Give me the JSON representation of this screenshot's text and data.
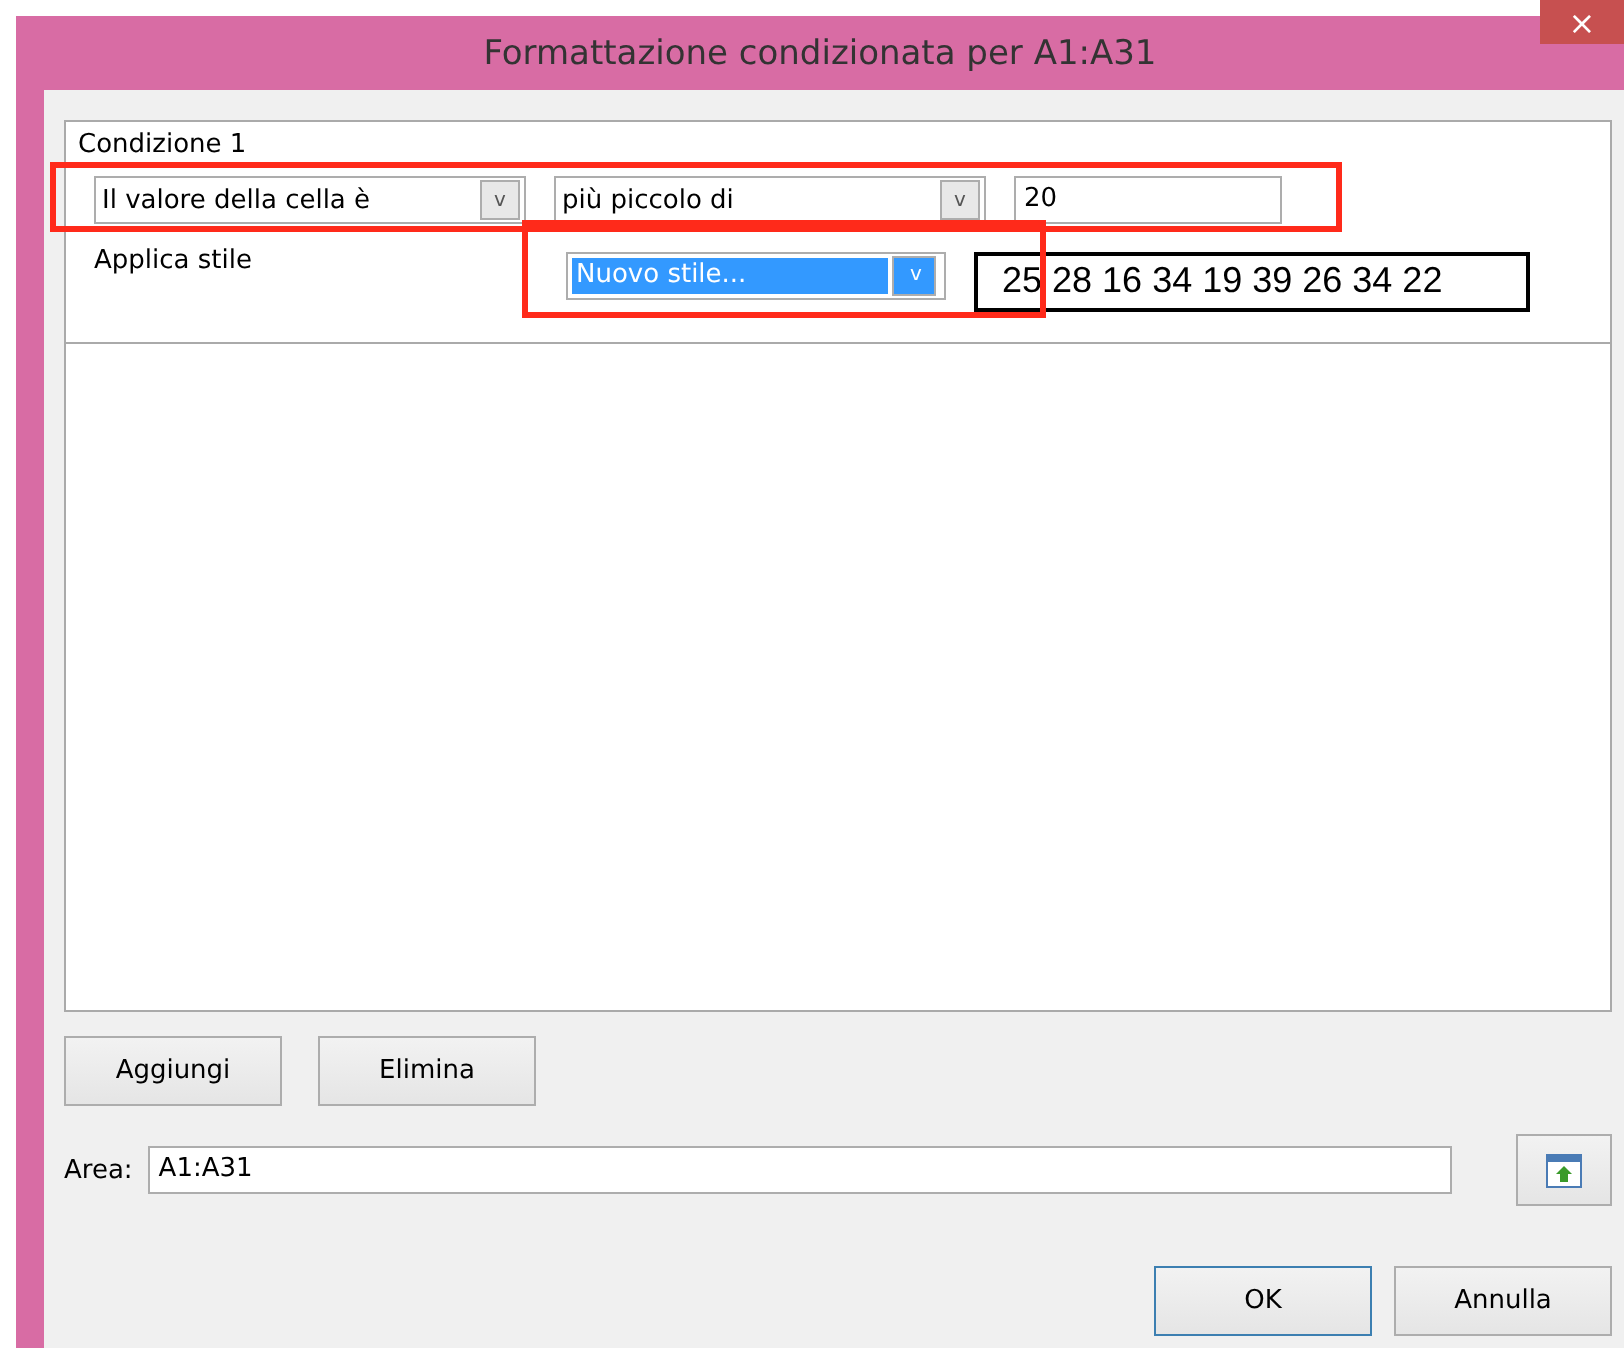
{
  "window": {
    "title": "Formattazione condizionata per A1:A31",
    "close": "×"
  },
  "conditions": [
    {
      "title": "Condizione 1",
      "highlighted": true,
      "type": {
        "value": "Il valore della cella è",
        "arrow": "v"
      },
      "operator": {
        "value": "più piccolo di",
        "arrow": "v"
      },
      "value": "20",
      "style_label": "Applica stile",
      "style": {
        "value": "Nuovo stile...",
        "arrow": "v",
        "selected": true,
        "highlighted": true
      },
      "preview": "25 28 16 34 19 39 26 34 22"
    }
  ],
  "buttons": [
    {
      "label": "Aggiungi"
    },
    {
      "label": "Elimina"
    }
  ],
  "area": {
    "label": "Area:",
    "value": "A1:A31"
  },
  "footer": [
    {
      "label": "OK",
      "default": true
    },
    {
      "label": "Annulla",
      "default": false
    }
  ]
}
